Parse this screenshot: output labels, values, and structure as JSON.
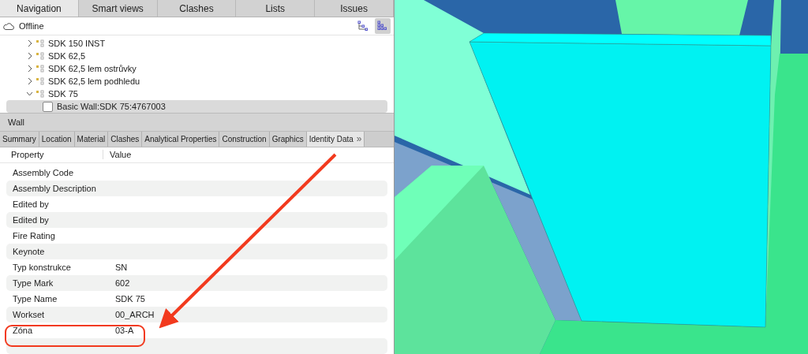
{
  "nav_tabs": [
    {
      "label": "Navigation",
      "selected": true
    },
    {
      "label": "Smart views",
      "selected": false
    },
    {
      "label": "Clashes",
      "selected": false
    },
    {
      "label": "Lists",
      "selected": false
    },
    {
      "label": "Issues",
      "selected": false
    }
  ],
  "status": {
    "label": "Offline"
  },
  "view_modes": [
    {
      "kind": "tree",
      "selected": false
    },
    {
      "kind": "grid",
      "selected": true
    }
  ],
  "tree": [
    {
      "label": "SDK 150 INST",
      "expanded": false,
      "selected": false
    },
    {
      "label": "SDK 62,5",
      "expanded": false,
      "selected": false
    },
    {
      "label": "SDK 62,5 lem ostrůvky",
      "expanded": false,
      "selected": false
    },
    {
      "label": "SDK 62,5 lem podhledu",
      "expanded": false,
      "selected": false
    },
    {
      "label": "SDK 75",
      "expanded": true,
      "selected": false,
      "children": [
        {
          "label": "Basic Wall:SDK 75:4767003",
          "selected": true
        }
      ]
    }
  ],
  "properties_panel": {
    "title": "Wall",
    "tabs": [
      {
        "label": "Summary",
        "selected": false
      },
      {
        "label": "Location",
        "selected": false
      },
      {
        "label": "Material",
        "selected": false
      },
      {
        "label": "Clashes",
        "selected": false
      },
      {
        "label": "Analytical Properties",
        "selected": false
      },
      {
        "label": "Construction",
        "selected": false
      },
      {
        "label": "Graphics",
        "selected": false
      },
      {
        "label": "Identity Data",
        "selected": true
      }
    ],
    "more_tabs": "»",
    "columns": [
      "Property",
      "Value"
    ],
    "rows": [
      {
        "property": "Assembly Code",
        "value": ""
      },
      {
        "property": "Assembly Description",
        "value": ""
      },
      {
        "property": "Edited by",
        "value": ""
      },
      {
        "property": "Edited by",
        "value": ""
      },
      {
        "property": "Fire Rating",
        "value": ""
      },
      {
        "property": "Keynote",
        "value": ""
      },
      {
        "property": "Typ konstrukce",
        "value": "SN"
      },
      {
        "property": "Type Mark",
        "value": "602"
      },
      {
        "property": "Type Name",
        "value": "SDK 75"
      },
      {
        "property": "Workset",
        "value": "00_ARCH"
      },
      {
        "property": "Zóna",
        "value": "03-A",
        "highlighted": true
      },
      {
        "property": "",
        "value": ""
      }
    ]
  }
}
